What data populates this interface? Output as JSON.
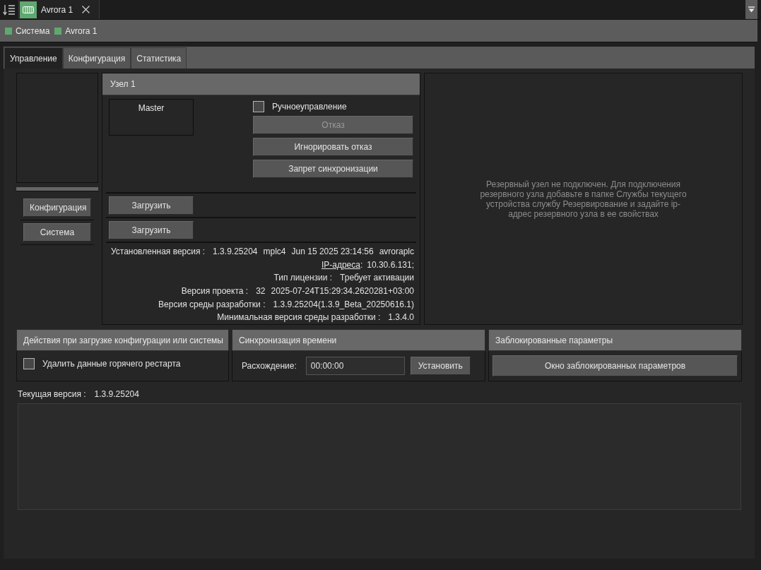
{
  "toolbar": {
    "doc_tabs": [
      {
        "label": "Avrora 1",
        "selected": true
      }
    ]
  },
  "breadcrumb": [
    {
      "label": "Система"
    },
    {
      "label": "Avrora 1"
    }
  ],
  "tabs": [
    {
      "label": "Управление",
      "selected": true
    },
    {
      "label": "Конфигурация",
      "selected": false
    },
    {
      "label": "Статистика",
      "selected": false
    }
  ],
  "sidebar": {
    "buttons": [
      "Конфигурация",
      "Система"
    ]
  },
  "node_panel": {
    "title": "Узел 1",
    "role": "Master",
    "manual_control": {
      "label": "Ручноеуправление",
      "checked": false
    },
    "actions": [
      {
        "label": "Отказ",
        "disabled": true
      },
      {
        "label": "Игнорировать отказ",
        "disabled": false
      },
      {
        "label": "Запрет синхронизации",
        "disabled": false
      }
    ],
    "load_buttons": [
      "Загрузить",
      "Загрузить"
    ],
    "info": [
      {
        "kind": "text",
        "label": "Установленная версия :",
        "values": [
          "1.3.9.25204",
          "mplc4",
          "Jun 15 2025 23:14:56",
          "avroraplc"
        ]
      },
      {
        "kind": "link",
        "label": "IP-адреса",
        "separator": ":",
        "values": [
          "10.30.6.131;"
        ]
      },
      {
        "kind": "text",
        "label": "Тип лицензии :",
        "values": [
          "Требует активации"
        ]
      },
      {
        "kind": "text",
        "label": "Версия проекта :",
        "values": [
          "32",
          "2025-07-24T15:29:34.2620281+03:00"
        ]
      },
      {
        "kind": "text",
        "label": "Версия среды разработки :",
        "values": [
          "1.3.9.25204(1.3.9_Beta_20250616.1)"
        ]
      },
      {
        "kind": "text",
        "label": "Минимальная версия среды разработки :",
        "values": [
          "1.3.4.0"
        ]
      }
    ]
  },
  "reserve_panel": {
    "message": "Резервный узел не подключен. Для подключения резервного узла добавьте в папке Службы текущего устройства службу Резервирование и задайте ip-адрес резервного узла в ее свойствах"
  },
  "load_actions": {
    "title": "Действия при загрузке конфигурации или системы",
    "checkbox": {
      "label": "Удалить данные горячего рестарта",
      "checked": false
    }
  },
  "time_sync": {
    "title": "Синхронизация времени",
    "label": "Расхождение:",
    "value": "00:00:00",
    "button": "Установить"
  },
  "blocked_params": {
    "title": "Заблокированные параметры",
    "button": "Окно заблокированных параметров"
  },
  "current_version": {
    "label": "Текущая версия :",
    "value": "1.3.9.25204"
  }
}
